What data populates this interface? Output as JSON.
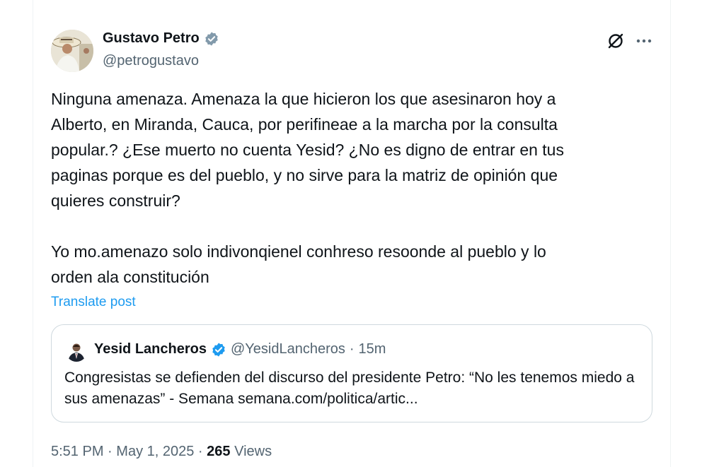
{
  "author": {
    "display_name": "Gustavo Petro",
    "handle": "@petrogustavo",
    "verified_icon": "verified-badge-icon",
    "avatar_icon": "profile-avatar"
  },
  "actions": {
    "grok_icon": "grok-icon",
    "more_icon": "more-options-icon"
  },
  "tweet": {
    "text": "Ninguna amenaza. Amenaza la que hicieron los que asesinaron hoy a\nAlberto, en Miranda, Cauca, por perifineae a la marcha por la consulta\npopular.? ¿Ese muerto no cuenta Yesid? ¿No es digno de entrar en tus\npaginas porque es del pueblo, y no sirve para la matriz de opinión que\nquieres construir?\n\nYo mo.amenazo solo indivonqienel conhreso resoonde al pueblo y lo\norden ala constitución",
    "translate_label": "Translate post"
  },
  "quote": {
    "display_name": "Yesid Lancheros",
    "handle": "@YesidLancheros",
    "separator": "·",
    "time": "15m",
    "text": "Congresistas se defienden del discurso del presidente Petro: “No les tenemos miedo a sus amenazas” - Semana semana.com/politica/artic..."
  },
  "meta": {
    "time": "5:51 PM",
    "sep1": "·",
    "date": "May 1, 2025",
    "sep2": "·",
    "views_count": "265",
    "views_label": "Views"
  },
  "colors": {
    "accent": "#1d9bf0",
    "secondary_text": "#536471",
    "border": "#cfd9de"
  }
}
